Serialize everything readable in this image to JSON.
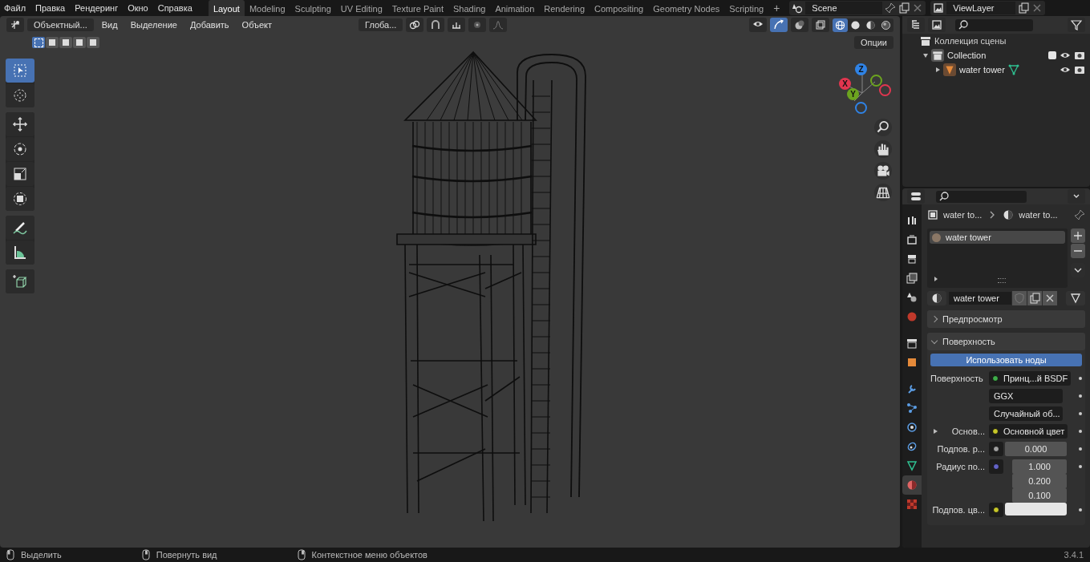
{
  "top_bar": {
    "menus": [
      "Файл",
      "Правка",
      "Рендеринг",
      "Окно",
      "Справка"
    ],
    "workspaces": [
      {
        "label": "Layout",
        "selected": true
      },
      {
        "label": "Modeling",
        "selected": false
      },
      {
        "label": "Sculpting",
        "selected": false
      },
      {
        "label": "UV Editing",
        "selected": false
      },
      {
        "label": "Texture Paint",
        "selected": false
      },
      {
        "label": "Shading",
        "selected": false
      },
      {
        "label": "Animation",
        "selected": false
      },
      {
        "label": "Rendering",
        "selected": false
      },
      {
        "label": "Compositing",
        "selected": false
      },
      {
        "label": "Geometry Nodes",
        "selected": false
      },
      {
        "label": "Scripting",
        "selected": false
      }
    ],
    "add_tab": "+",
    "scene": "Scene",
    "view_layer": "ViewLayer"
  },
  "viewport": {
    "mode": "Объектный...",
    "menus": [
      "Вид",
      "Выделение",
      "Добавить",
      "Объект"
    ],
    "orientation": "Глоба...",
    "options": "Опции",
    "select_modes": [
      {
        "selected": true
      },
      {
        "selected": false
      },
      {
        "selected": false
      },
      {
        "selected": false
      },
      {
        "selected": false
      }
    ],
    "tool_groups": [
      [
        {
          "kind": "select",
          "selected": true
        },
        {
          "kind": "cursor",
          "selected": false
        }
      ],
      [
        {
          "kind": "move",
          "selected": false
        },
        {
          "kind": "rotate",
          "selected": false
        },
        {
          "kind": "scale",
          "selected": false
        },
        {
          "kind": "transform",
          "selected": false
        }
      ],
      [
        {
          "kind": "annotate",
          "selected": false
        },
        {
          "kind": "measure",
          "selected": false
        }
      ],
      [
        {
          "kind": "add-cube",
          "selected": false
        }
      ]
    ],
    "shading": [
      {
        "kind": "wireframe",
        "selected": true
      },
      {
        "kind": "solid",
        "selected": false
      },
      {
        "kind": "material",
        "selected": false
      },
      {
        "kind": "rendered",
        "selected": false
      }
    ],
    "gizmo": {
      "x": "X",
      "y": "Y",
      "z": "Z"
    }
  },
  "outliner": {
    "title": "Коллекция сцены",
    "items": [
      {
        "name": "Collection",
        "kind": "collection",
        "expanded": true,
        "checked": true,
        "children": [
          {
            "name": "water tower",
            "kind": "mesh",
            "expanded": false
          }
        ]
      }
    ]
  },
  "properties": {
    "tabs": [
      {
        "kind": "tool",
        "selected": false
      },
      {
        "kind": "render",
        "selected": false
      },
      {
        "kind": "output",
        "selected": false
      },
      {
        "kind": "view-layer",
        "selected": false
      },
      {
        "kind": "scene",
        "selected": false
      },
      {
        "kind": "world",
        "selected": false
      },
      {
        "kind": "collection",
        "selected": false
      },
      {
        "kind": "object",
        "selected": false
      },
      {
        "kind": "modifier",
        "selected": false
      },
      {
        "kind": "particles",
        "selected": false
      },
      {
        "kind": "physics",
        "selected": false
      },
      {
        "kind": "constraints",
        "selected": false
      },
      {
        "kind": "data",
        "selected": false
      },
      {
        "kind": "material",
        "selected": true
      },
      {
        "kind": "texture",
        "selected": false
      }
    ],
    "breadcrumb": [
      "water to...",
      "water to..."
    ],
    "slots": [
      {
        "name": "water tower",
        "selected": true
      }
    ],
    "material": "water tower",
    "panels": [
      {
        "title": "Предпросмотр",
        "expanded": false
      },
      {
        "title": "Поверхность",
        "expanded": true
      }
    ],
    "use_nodes": "Использовать ноды",
    "rows": [
      {
        "kind": "link",
        "label": "Поверхность",
        "color": "#3fae4a",
        "value": "Принц...й BSDF"
      },
      {
        "kind": "dropdown",
        "value": "GGX"
      },
      {
        "kind": "dropdown",
        "value": "Случайный об..."
      },
      {
        "kind": "link",
        "label": "Основ...",
        "expanded": false,
        "color": "#c7c729",
        "value": "Основной цвет"
      },
      {
        "kind": "number",
        "label": "Подпов. р...",
        "color": "#a1a1a1",
        "values": [
          "0.000"
        ]
      },
      {
        "kind": "number",
        "label": "Радиус по...",
        "color": "#6363c7",
        "values": [
          "1.000",
          "0.200",
          "0.100"
        ]
      },
      {
        "kind": "color",
        "label": "Подпов. цв...",
        "color": "#c7c729",
        "swatch": {
          "color": "#e6e6e6"
        }
      }
    ]
  },
  "status_bar": {
    "hints": [
      "Выделить",
      "Повернуть вид",
      "Контекстное меню объектов"
    ],
    "version": "3.4.1"
  }
}
